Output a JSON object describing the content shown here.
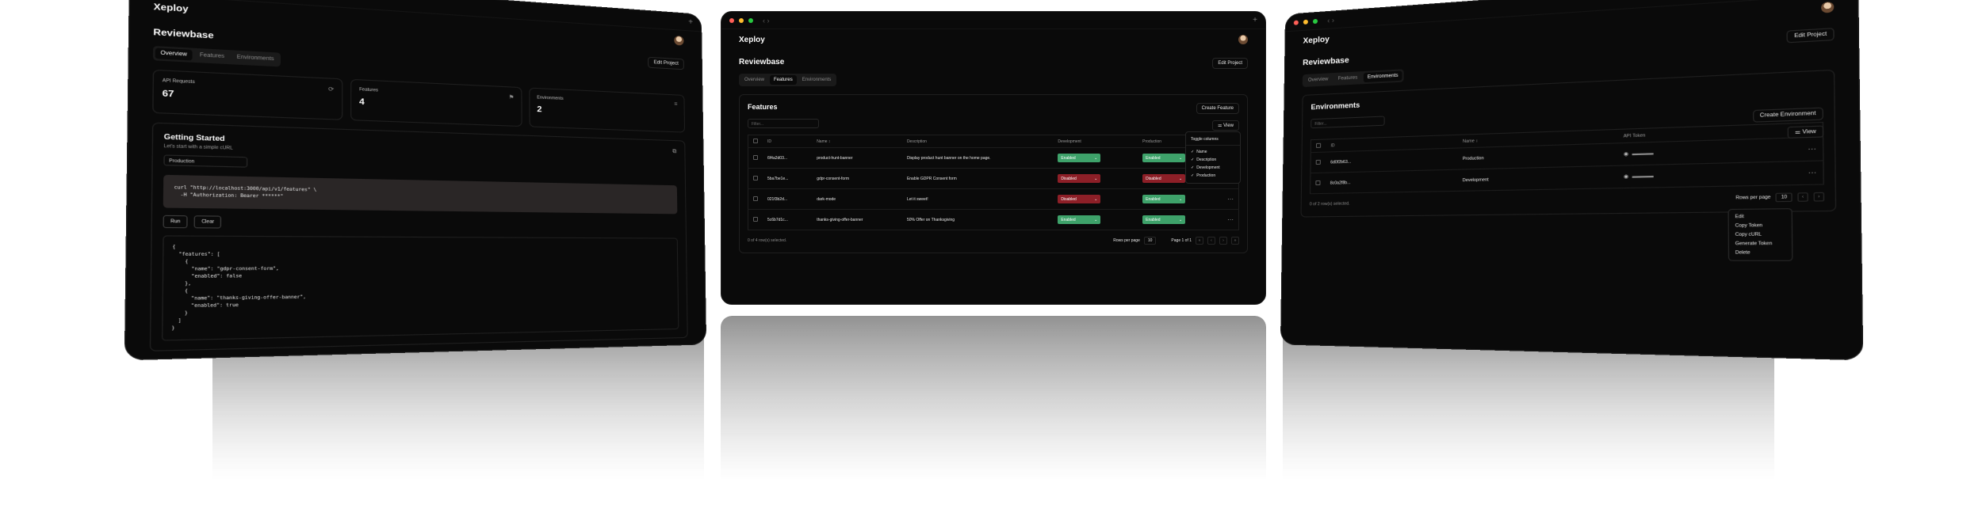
{
  "app": {
    "brand": "Xeploy",
    "project_title": "Reviewbase",
    "edit_project": "Edit Project"
  },
  "tabs": [
    "Overview",
    "Features",
    "Environments"
  ],
  "features": {
    "title": "Features",
    "create_label": "Create Feature",
    "filter_placeholder": "Filter...",
    "view_label": "View",
    "columns": [
      "ID",
      "Name",
      "Description",
      "Development",
      "Production"
    ],
    "rows": [
      {
        "id": "6f4a2d03...",
        "name": "product-hunt-banner",
        "description": "Display product hunt banner on the home page.",
        "dev": "Enabled",
        "prod": "Enabled"
      },
      {
        "id": "5ba7be1e...",
        "name": "gdpr-consent-form",
        "description": "Enable GDPR Consent form",
        "dev": "Disabled",
        "prod": "Disabled"
      },
      {
        "id": "021f3b2d...",
        "name": "dark-mode",
        "description": "Let it sweet!",
        "dev": "Disabled",
        "prod": "Enabled"
      },
      {
        "id": "5c6b7d1c...",
        "name": "thanks-giving-offer-banner",
        "description": "50% Offer on Thanksgiving",
        "dev": "Enabled",
        "prod": "Enabled"
      }
    ],
    "selection_text": "0 of 4 row(s) selected.",
    "rows_per_page_label": "Rows per page",
    "rows_per_page_value": "10",
    "page_text": "Page 1 of 1",
    "column_menu": {
      "header": "Toggle columns",
      "items": [
        "Name",
        "Description",
        "Development",
        "Production"
      ]
    }
  },
  "overview": {
    "stats": [
      {
        "label": "API Requests",
        "value": "67"
      },
      {
        "label": "Features",
        "value": "4"
      },
      {
        "label": "Environments",
        "value": "2"
      }
    ],
    "getting_started_title": "Getting Started",
    "getting_started_sub": "Let's start with a simple cURL",
    "env_select": "Production",
    "code": "curl \"http://localhost:3000/api/v1/features\" \\\n  -H \"Authorization: Bearer ******\"",
    "run_label": "Run",
    "clear_label": "Clear",
    "json": "{\n  \"features\": [\n    {\n      \"name\": \"gdpr-consent-form\",\n      \"enabled\": false\n    },\n    {\n      \"name\": \"thanks-giving-offer-banner\",\n      \"enabled\": true\n    }\n  ]\n}"
  },
  "environments": {
    "title": "Environments",
    "create_label": "Create Environment",
    "filter_placeholder": "Filter...",
    "view_label": "View",
    "columns": [
      "ID",
      "Name",
      "API Token"
    ],
    "rows": [
      {
        "id": "6d0f2b63...",
        "name": "Production"
      },
      {
        "id": "8c0a2f8b...",
        "name": "Development"
      }
    ],
    "selection_text": "0 of 2 row(s) selected.",
    "rows_per_page_label": "Rows per page",
    "rows_per_page_value": "10",
    "row_menu": [
      "Edit",
      "Copy Token",
      "Copy cURL",
      "Generate Token",
      "Delete"
    ]
  }
}
